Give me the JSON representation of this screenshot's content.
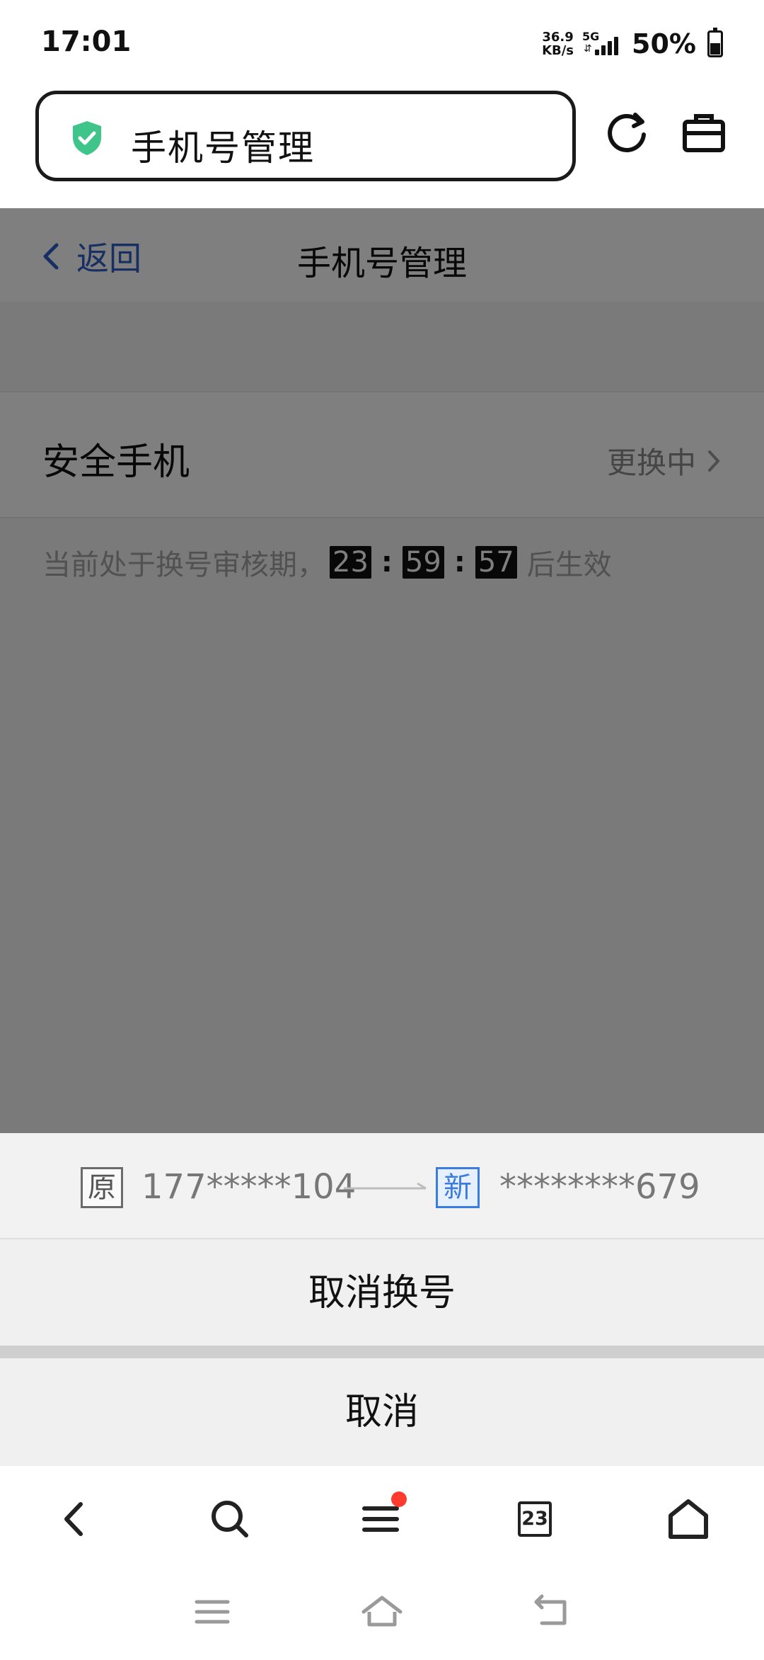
{
  "status_bar": {
    "time": "17:01",
    "net_speed_value": "36.9",
    "net_speed_unit": "KB/s",
    "network": "5G",
    "battery_percent": "50%"
  },
  "browser": {
    "address_text": "手机号管理",
    "security_color": "#3fc48a"
  },
  "page": {
    "back_label": "返回",
    "title": "手机号管理",
    "row_label": "安全手机",
    "row_status": "更换中",
    "notice_prefix": "当前处于换号审核期，",
    "countdown": {
      "hours": "23",
      "minutes": "59",
      "seconds": "57"
    },
    "notice_suffix": "后生效"
  },
  "sheet": {
    "old_tag": "原",
    "old_number": "177*****104",
    "new_tag": "新",
    "new_number": "********679",
    "cancel_change_label": "取消换号",
    "cancel_label": "取消"
  },
  "toolbar": {
    "tabs_count": "23",
    "accent_color": "#2f5fc4",
    "badge_color": "#ff3b30"
  }
}
